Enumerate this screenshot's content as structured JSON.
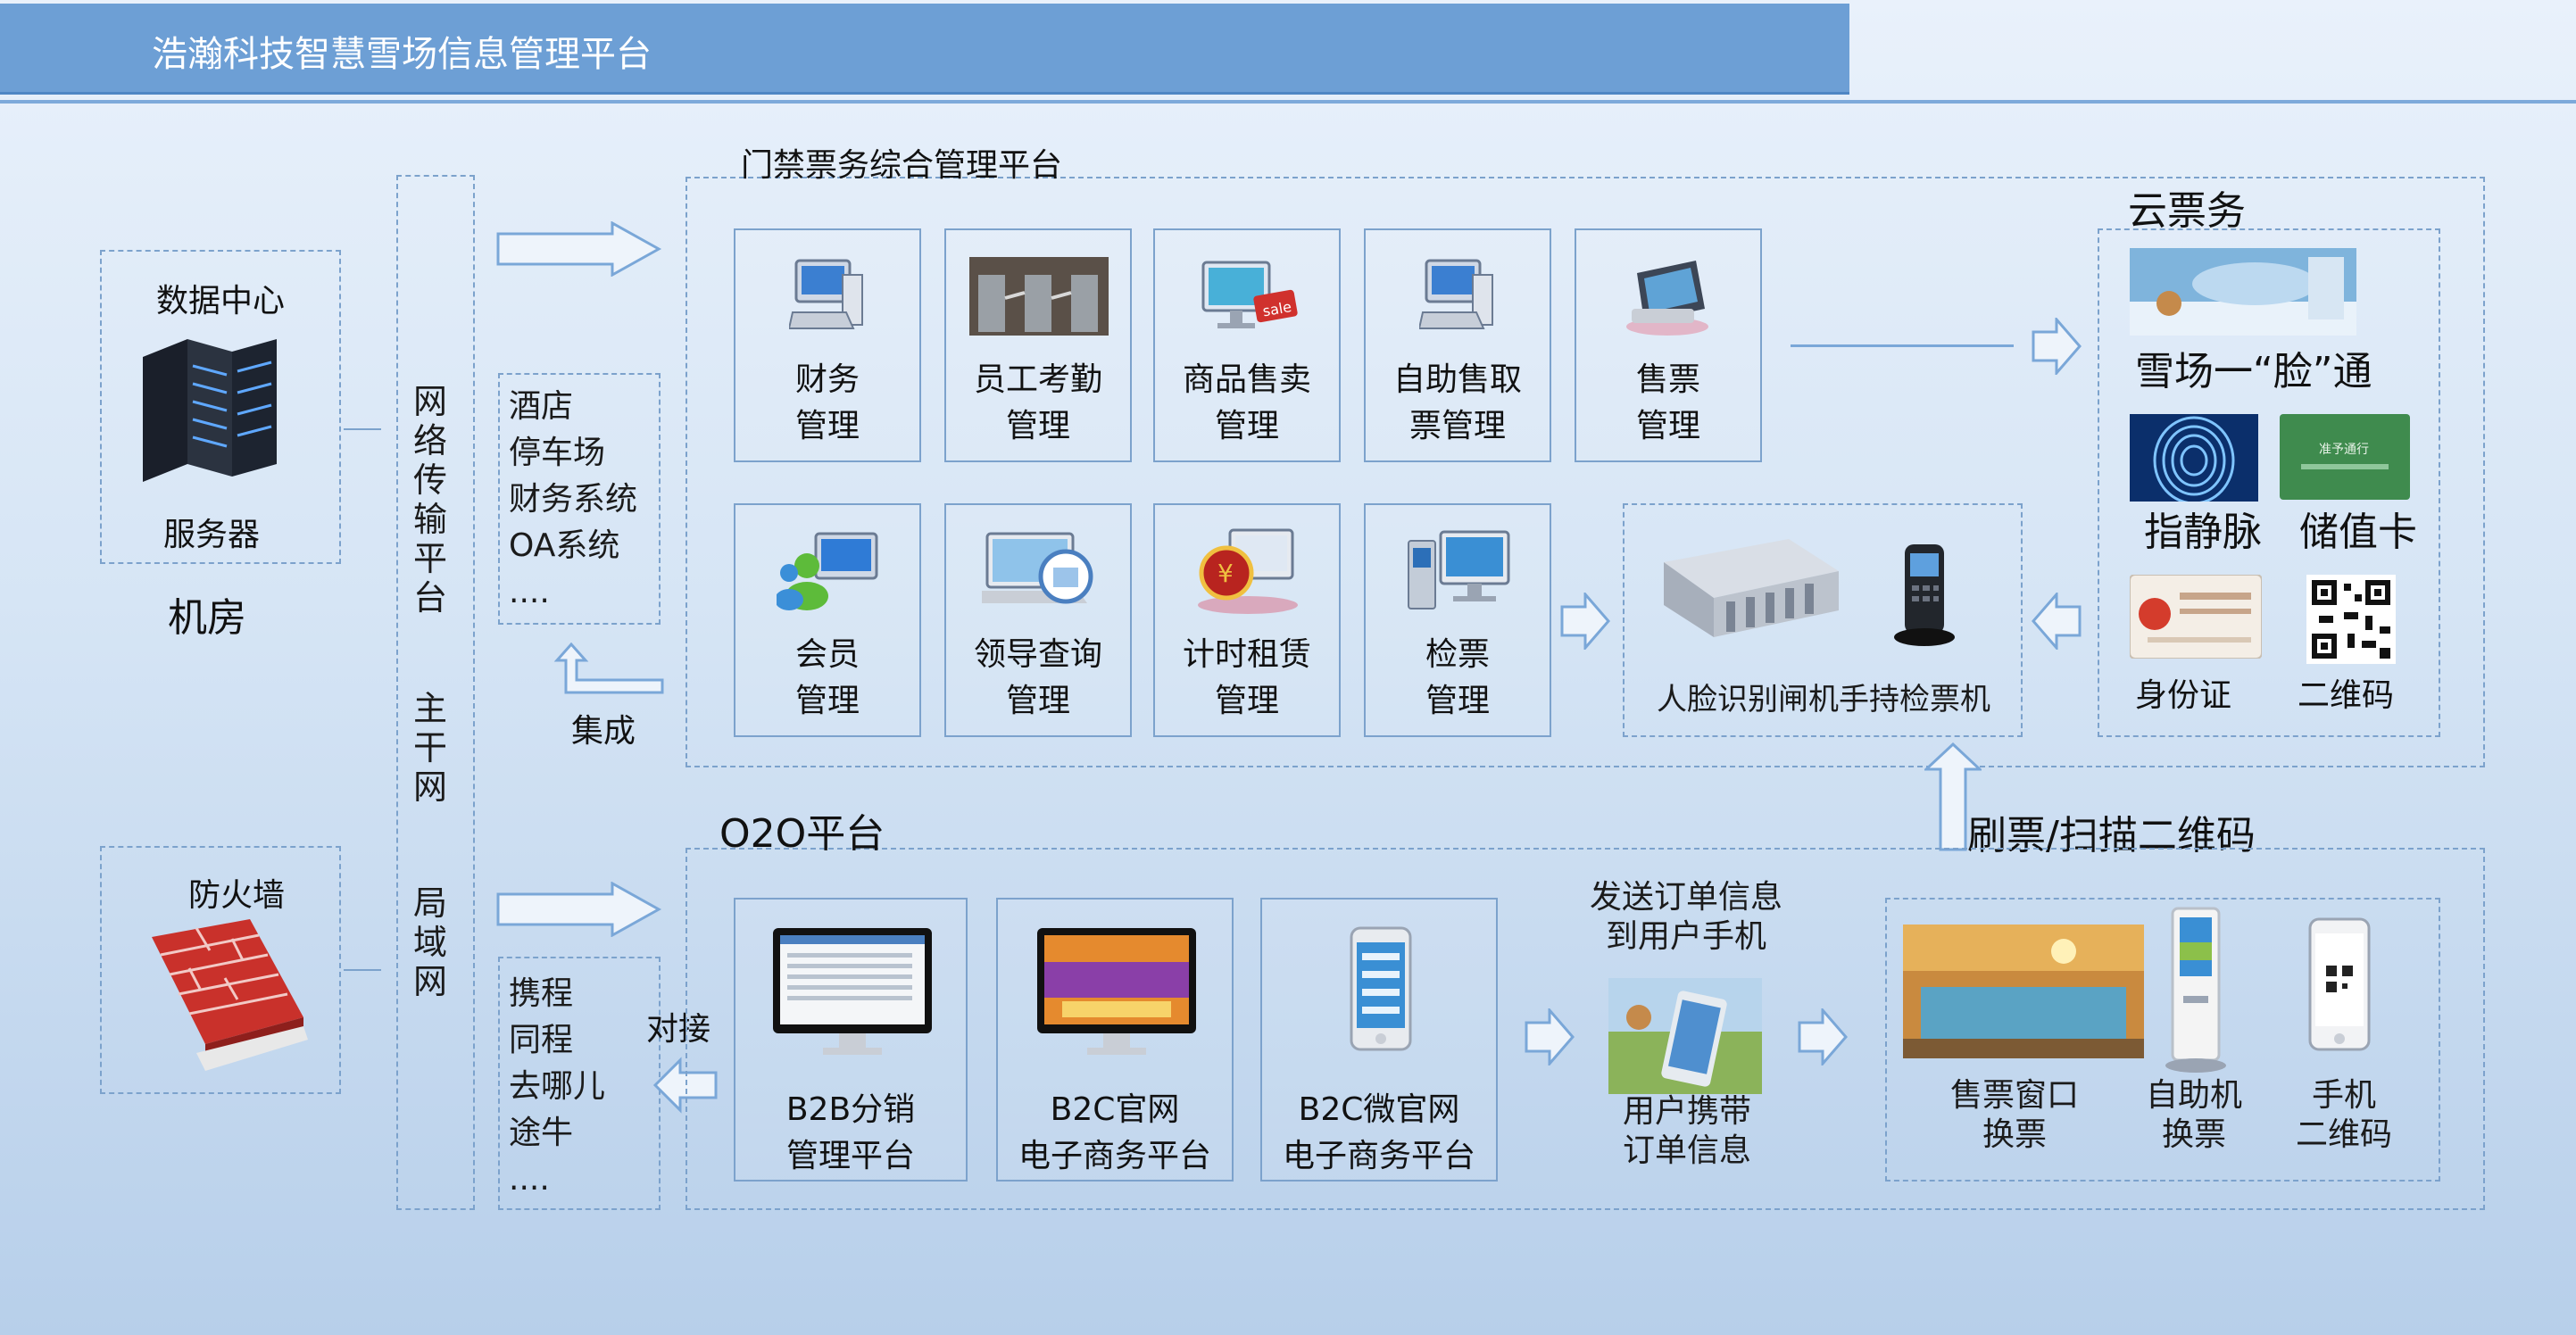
{
  "header": {
    "title": "浩瀚科技智慧雪场信息管理平台"
  },
  "left": {
    "datacenter_label": "数据中心",
    "server_label": "服务器",
    "machine_room_label": "机房",
    "firewall_label": "防火墙"
  },
  "network": {
    "transport": "网络传输平台",
    "backbone": "主干网",
    "lan": "局域网"
  },
  "integration": {
    "items": [
      "酒店",
      "停车场",
      "财务系统",
      "OA系统",
      "...."
    ],
    "label": "集成"
  },
  "docking": {
    "items": [
      "携程",
      "同程",
      "去哪儿",
      "途牛",
      "...."
    ],
    "label": "对接"
  },
  "access_platform": {
    "title": "门禁票务综合管理平台",
    "row1": [
      {
        "line1": "财务",
        "line2": "管理",
        "icon": "computer-icon"
      },
      {
        "line1": "员工考勤",
        "line2": "管理",
        "icon": "turnstile-icon"
      },
      {
        "line1": "商品售卖",
        "line2": "管理",
        "icon": "sale-monitor-icon"
      },
      {
        "line1": "自助售取",
        "line2": "票管理",
        "icon": "computer-icon"
      },
      {
        "line1": "售票",
        "line2": "管理",
        "icon": "pos-terminal-icon"
      }
    ],
    "row2": [
      {
        "line1": "会员",
        "line2": "管理",
        "icon": "users-monitor-icon"
      },
      {
        "line1": "领导查询",
        "line2": "管理",
        "icon": "laptop-search-icon"
      },
      {
        "line1": "计时租赁",
        "line2": "管理",
        "icon": "monitor-clock-icon"
      },
      {
        "line1": "检票",
        "line2": "管理",
        "icon": "kiosk-monitor-icon"
      }
    ],
    "gate_labels": {
      "face_gate": "人脸识别闸机",
      "handheld": "手持检票机"
    }
  },
  "cloud": {
    "title": "云票务",
    "items": [
      {
        "label": "雪场一“脸”通",
        "icon": "face-banner-icon"
      },
      {
        "label": "指静脉",
        "icon": "fingerprint-icon"
      },
      {
        "label": "储值卡",
        "icon": "card-icon"
      },
      {
        "label": "身份证",
        "icon": "id-card-icon"
      },
      {
        "label": "二维码",
        "icon": "qrcode-icon"
      }
    ],
    "card_text": "准予通行"
  },
  "o2o": {
    "title": "O2O平台",
    "platforms": [
      {
        "line1": "B2B分销",
        "line2": "管理平台"
      },
      {
        "line1": "B2C官网",
        "line2": "电子商务平台"
      },
      {
        "line1": "B2C微官网",
        "line2": "电子商务平台"
      }
    ],
    "send_order": {
      "line1": "发送订单信息",
      "line2": "到用户手机"
    },
    "user_carry": {
      "line1": "用户携带",
      "line2": "订单信息"
    },
    "swipe_label": "刷票/扫描二维码",
    "redeem": [
      {
        "line1": "售票窗口",
        "line2": "换票"
      },
      {
        "line1": "自助机",
        "line2": "换票"
      },
      {
        "line1": "手机",
        "line2": "二维码"
      }
    ]
  },
  "colors": {
    "title_bar": "#6d9fd5",
    "dashed_border": "#7ca2cc",
    "arrow": "#7aa7d8",
    "background": "#dbe8f6"
  }
}
